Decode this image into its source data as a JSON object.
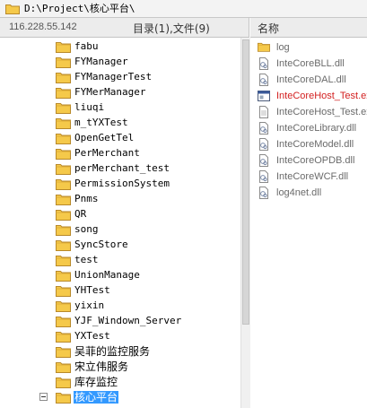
{
  "address_bar": {
    "path": "D:\\Project\\核心平台\\"
  },
  "left_header": {
    "host_ip": "116.228.55.142",
    "count_text": "目录(1),文件(9)"
  },
  "right_header": {
    "column_name": "名称"
  },
  "tree": {
    "items": [
      {
        "label": "fabu"
      },
      {
        "label": "FYManager"
      },
      {
        "label": "FYManagerTest"
      },
      {
        "label": "FYMerManager"
      },
      {
        "label": "liuqi"
      },
      {
        "label": "m_tYXTest"
      },
      {
        "label": "OpenGetTel"
      },
      {
        "label": "PerMerchant"
      },
      {
        "label": "perMerchant_test"
      },
      {
        "label": "PermissionSystem"
      },
      {
        "label": "Pnms"
      },
      {
        "label": "QR"
      },
      {
        "label": "song"
      },
      {
        "label": "SyncStore"
      },
      {
        "label": "test"
      },
      {
        "label": "UnionManage"
      },
      {
        "label": "YHTest"
      },
      {
        "label": "yixin"
      },
      {
        "label": "YJF_Windown_Server"
      },
      {
        "label": "YXTest"
      },
      {
        "label": "吴菲的监控服务"
      },
      {
        "label": "宋立伟服务"
      },
      {
        "label": "库存监控"
      },
      {
        "label": "核心平台",
        "selected": true,
        "expanded": true
      }
    ]
  },
  "files": {
    "items": [
      {
        "name": "log",
        "type": "folder"
      },
      {
        "name": "InteCoreBLL.dll",
        "type": "dll"
      },
      {
        "name": "InteCoreDAL.dll",
        "type": "dll"
      },
      {
        "name": "InteCoreHost_Test.exe",
        "type": "exe"
      },
      {
        "name": "InteCoreHost_Test.exe",
        "type": "file"
      },
      {
        "name": "InteCoreLibrary.dll",
        "type": "dll"
      },
      {
        "name": "InteCoreModel.dll",
        "type": "dll"
      },
      {
        "name": "InteCoreOPDB.dll",
        "type": "dll"
      },
      {
        "name": "InteCoreWCF.dll",
        "type": "dll"
      },
      {
        "name": "log4net.dll",
        "type": "dll"
      }
    ]
  },
  "colors": {
    "folder": "#f5c94a",
    "selection": "#3399ff",
    "exe_text": "#d32020",
    "file_text": "#6a6a6a"
  }
}
